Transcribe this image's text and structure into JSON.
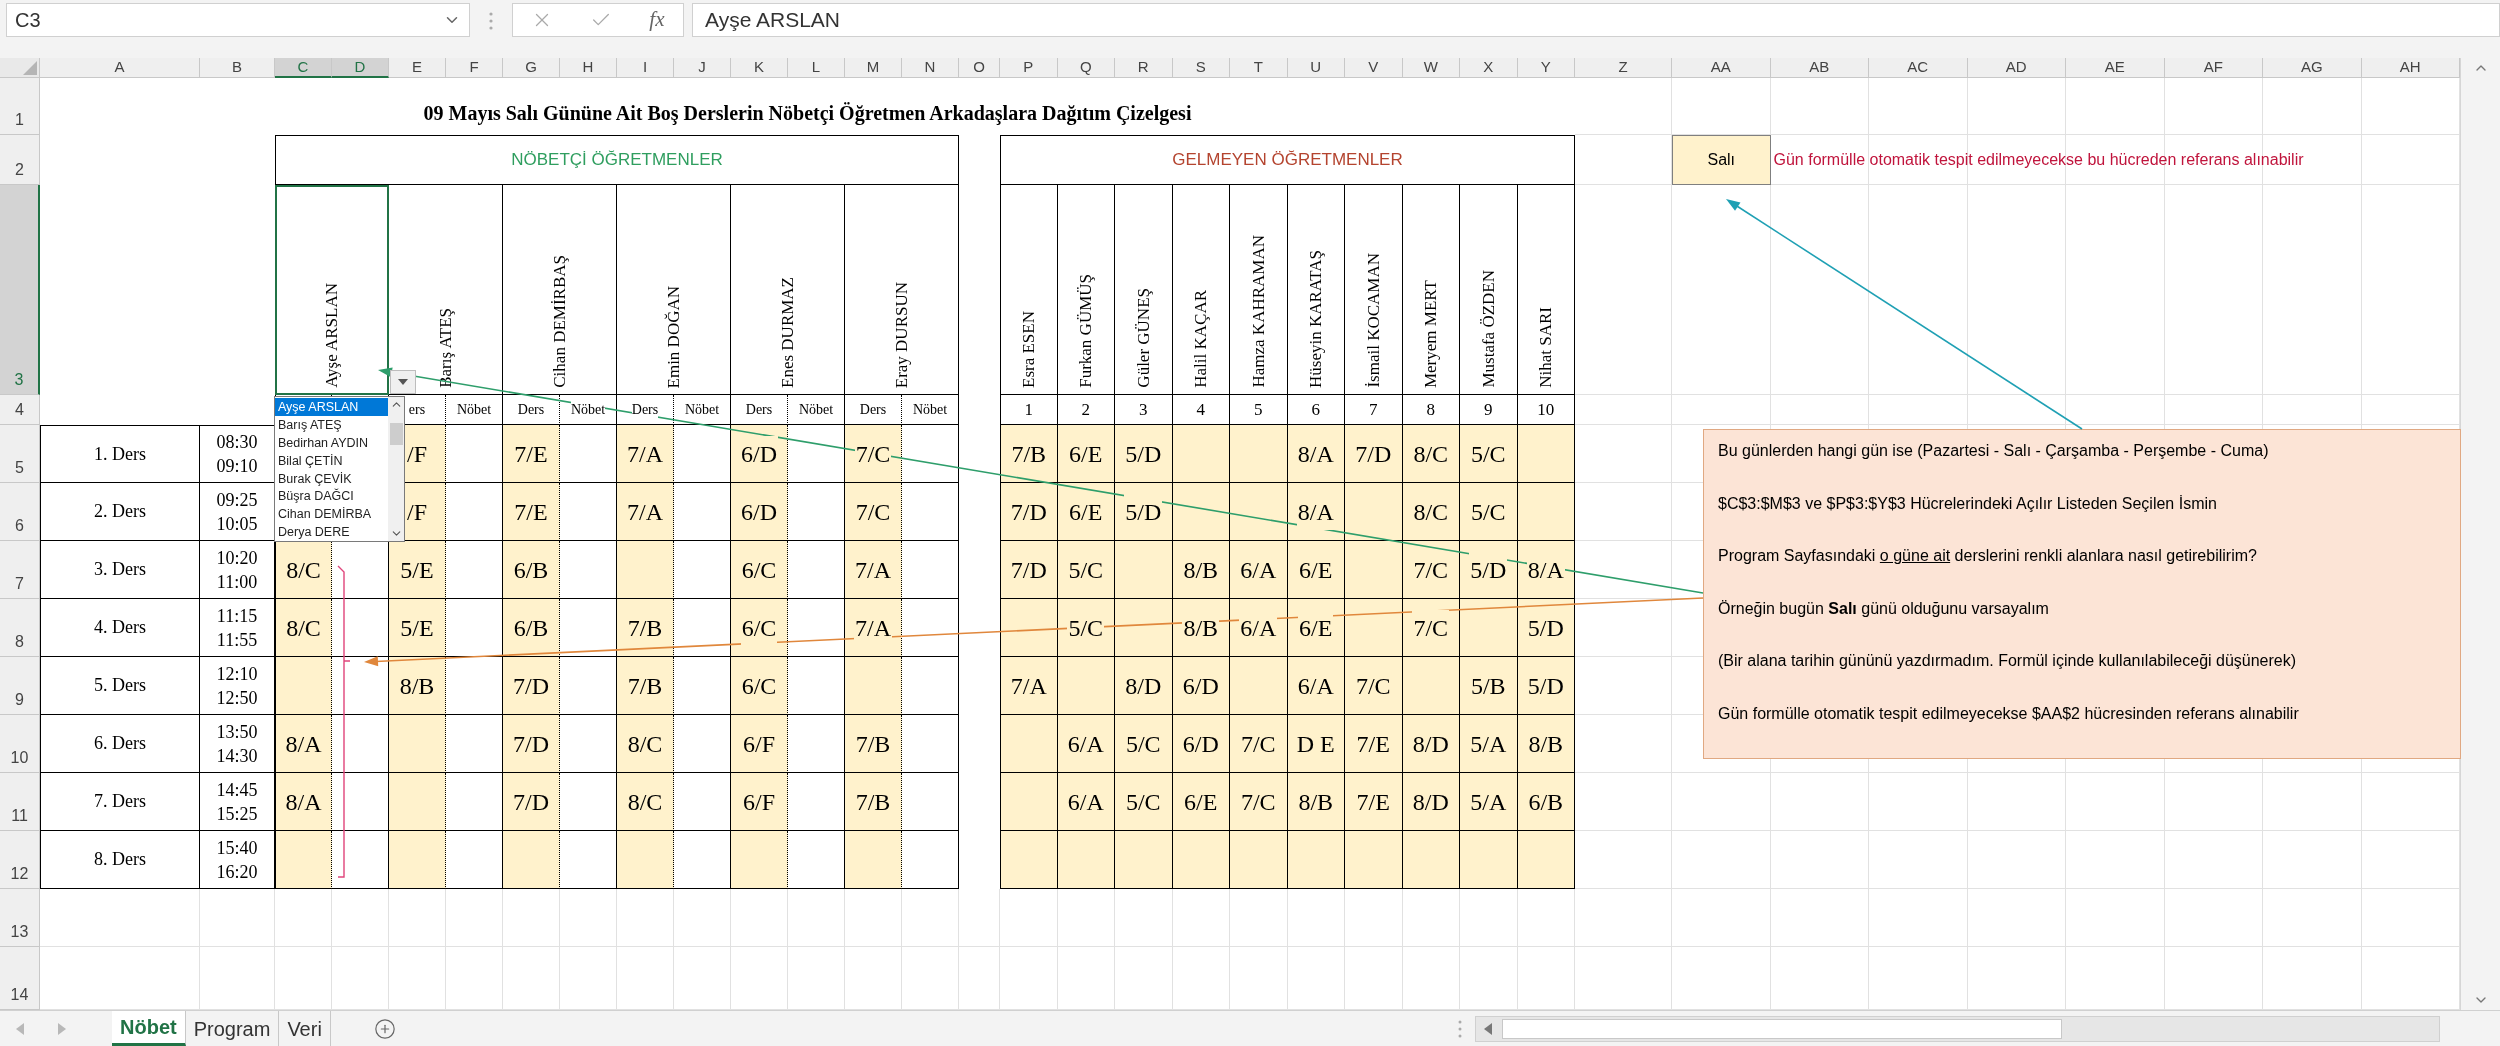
{
  "formula_bar": {
    "name_box": "C3",
    "function_label": "fx",
    "formula": "Ayşe ARSLAN"
  },
  "column_headers": [
    {
      "label": "A",
      "selected": false
    },
    {
      "label": "B",
      "selected": false
    },
    {
      "label": "C",
      "selected": true
    },
    {
      "label": "D",
      "selected": true
    },
    {
      "label": "E",
      "selected": false
    },
    {
      "label": "F",
      "selected": false
    },
    {
      "label": "G",
      "selected": false
    },
    {
      "label": "H",
      "selected": false
    },
    {
      "label": "I",
      "selected": false
    },
    {
      "label": "J",
      "selected": false
    },
    {
      "label": "K",
      "selected": false
    },
    {
      "label": "L",
      "selected": false
    },
    {
      "label": "M",
      "selected": false
    },
    {
      "label": "N",
      "selected": false
    },
    {
      "label": "O",
      "selected": false
    },
    {
      "label": "P",
      "selected": false
    },
    {
      "label": "Q",
      "selected": false
    },
    {
      "label": "R",
      "selected": false
    },
    {
      "label": "S",
      "selected": false
    },
    {
      "label": "T",
      "selected": false
    },
    {
      "label": "U",
      "selected": false
    },
    {
      "label": "V",
      "selected": false
    },
    {
      "label": "W",
      "selected": false
    },
    {
      "label": "X",
      "selected": false
    },
    {
      "label": "Y",
      "selected": false
    },
    {
      "label": "Z",
      "selected": false
    },
    {
      "label": "AA",
      "selected": false
    },
    {
      "label": "AB",
      "selected": false
    },
    {
      "label": "AC",
      "selected": false
    },
    {
      "label": "AD",
      "selected": false
    },
    {
      "label": "AE",
      "selected": false
    },
    {
      "label": "AF",
      "selected": false
    },
    {
      "label": "AG",
      "selected": false
    },
    {
      "label": "AH",
      "selected": false
    }
  ],
  "row_headers": [
    {
      "label": "1",
      "selected": false
    },
    {
      "label": "2",
      "selected": false
    },
    {
      "label": "3",
      "selected": true
    },
    {
      "label": "4",
      "selected": false
    },
    {
      "label": "5",
      "selected": false
    },
    {
      "label": "6",
      "selected": false
    },
    {
      "label": "7",
      "selected": false
    },
    {
      "label": "8",
      "selected": false
    },
    {
      "label": "9",
      "selected": false
    },
    {
      "label": "10",
      "selected": false
    },
    {
      "label": "11",
      "selected": false
    },
    {
      "label": "12",
      "selected": false
    },
    {
      "label": "13",
      "selected": false
    },
    {
      "label": "14",
      "selected": false
    }
  ],
  "title": "09 Mayıs Salı Gününe Ait Boş Derslerin Nöbetçi Öğretmen Arkadaşlara Dağıtım Çizelgesi",
  "duty_table": {
    "heading": "NÖBETÇİ ÖĞRETMENLER",
    "teachers": [
      {
        "name": "Ayşe ARSLAN",
        "selected": true
      },
      {
        "name": "Barış ATEŞ",
        "selected": false,
        "sub_headers": [
          "ers",
          "Nöbet"
        ]
      },
      {
        "name": "Cihan DEMİRBAŞ",
        "selected": false,
        "sub_headers": [
          "Ders",
          "Nöbet"
        ]
      },
      {
        "name": "Emin DOĞAN",
        "selected": false,
        "sub_headers": [
          "Ders",
          "Nöbet"
        ]
      },
      {
        "name": "Enes DURMAZ",
        "selected": false,
        "sub_headers": [
          "Ders",
          "Nöbet"
        ]
      },
      {
        "name": "Eray DURSUN",
        "selected": false,
        "sub_headers": [
          "Ders",
          "Nöbet"
        ]
      }
    ]
  },
  "absent_table": {
    "heading": "GELMEYEN ÖĞRETMENLER",
    "teachers": [
      {
        "name": "Esra ESEN",
        "number": "1"
      },
      {
        "name": "Furkan GÜMÜŞ",
        "number": "2"
      },
      {
        "name": "Güler GÜNEŞ",
        "number": "3"
      },
      {
        "name": "Halil KAÇAR",
        "number": "4"
      },
      {
        "name": "Hamza KAHRAMAN",
        "number": "5"
      },
      {
        "name": "Hüseyin KARATAŞ",
        "number": "6"
      },
      {
        "name": "İsmail KOCAMAN",
        "number": "7"
      },
      {
        "name": "Meryem MERT",
        "number": "8"
      },
      {
        "name": "Mustafa ÖZDEN",
        "number": "9"
      },
      {
        "name": "Nihat SARI",
        "number": "10"
      }
    ]
  },
  "periods": [
    {
      "label": "1. Ders",
      "start": "08:30",
      "end": "09:10",
      "duty": [
        {
          "kind": "hidden"
        },
        {
          "kind": "lesson",
          "text": "/F"
        },
        {
          "kind": "lesson",
          "text": "7/E"
        },
        {
          "kind": "lesson",
          "text": "7/A"
        },
        {
          "kind": "lesson",
          "text": "6/D"
        },
        {
          "kind": "lesson",
          "text": "7/C"
        }
      ],
      "absent": [
        {
          "kind": "lesson",
          "text": "7/B"
        },
        {
          "kind": "lesson",
          "text": "6/E"
        },
        {
          "kind": "lesson",
          "text": "5/D"
        },
        {
          "kind": "empty"
        },
        {
          "kind": "empty"
        },
        {
          "kind": "lesson",
          "text": "8/A"
        },
        {
          "kind": "lesson",
          "text": "7/D"
        },
        {
          "kind": "lesson",
          "text": "8/C"
        },
        {
          "kind": "lesson",
          "text": "5/C"
        },
        {
          "kind": "empty"
        }
      ]
    },
    {
      "label": "2. Ders",
      "start": "09:25",
      "end": "10:05",
      "duty": [
        {
          "kind": "hidden"
        },
        {
          "kind": "lesson",
          "text": "/F"
        },
        {
          "kind": "lesson",
          "text": "7/E"
        },
        {
          "kind": "lesson",
          "text": "7/A"
        },
        {
          "kind": "lesson",
          "text": "6/D"
        },
        {
          "kind": "lesson",
          "text": "7/C"
        }
      ],
      "absent": [
        {
          "kind": "lesson",
          "text": "7/D"
        },
        {
          "kind": "lesson",
          "text": "6/E"
        },
        {
          "kind": "lesson",
          "text": "5/D"
        },
        {
          "kind": "empty"
        },
        {
          "kind": "empty"
        },
        {
          "kind": "lesson",
          "text": "8/A"
        },
        {
          "kind": "empty"
        },
        {
          "kind": "lesson",
          "text": "8/C"
        },
        {
          "kind": "lesson",
          "text": "5/C"
        },
        {
          "kind": "empty"
        }
      ]
    },
    {
      "label": "3. Ders",
      "start": "10:20",
      "end": "11:00",
      "duty": [
        {
          "kind": "lesson",
          "text": "8/C"
        },
        {
          "kind": "lesson",
          "text": "5/E"
        },
        {
          "kind": "lesson",
          "text": "6/B"
        },
        {
          "kind": "empty"
        },
        {
          "kind": "lesson",
          "text": "6/C"
        },
        {
          "kind": "lesson",
          "text": "7/A"
        }
      ],
      "absent": [
        {
          "kind": "lesson",
          "text": "7/D"
        },
        {
          "kind": "lesson",
          "text": "5/C"
        },
        {
          "kind": "empty"
        },
        {
          "kind": "lesson",
          "text": "8/B"
        },
        {
          "kind": "lesson",
          "text": "6/A"
        },
        {
          "kind": "lesson",
          "text": "6/E"
        },
        {
          "kind": "empty"
        },
        {
          "kind": "lesson",
          "text": "7/C"
        },
        {
          "kind": "lesson",
          "text": "5/D"
        },
        {
          "kind": "lesson",
          "text": "8/A"
        }
      ]
    },
    {
      "label": "4. Ders",
      "start": "11:15",
      "end": "11:55",
      "duty": [
        {
          "kind": "lesson",
          "text": "8/C"
        },
        {
          "kind": "lesson",
          "text": "5/E"
        },
        {
          "kind": "lesson",
          "text": "6/B"
        },
        {
          "kind": "lesson",
          "text": "7/B"
        },
        {
          "kind": "lesson",
          "text": "6/C"
        },
        {
          "kind": "lesson",
          "text": "7/A"
        }
      ],
      "absent": [
        {
          "kind": "empty"
        },
        {
          "kind": "lesson",
          "text": "5/C"
        },
        {
          "kind": "empty"
        },
        {
          "kind": "lesson",
          "text": "8/B"
        },
        {
          "kind": "lesson",
          "text": "6/A"
        },
        {
          "kind": "lesson",
          "text": "6/E"
        },
        {
          "kind": "empty"
        },
        {
          "kind": "lesson",
          "text": "7/C"
        },
        {
          "kind": "empty"
        },
        {
          "kind": "lesson",
          "text": "5/D"
        }
      ]
    },
    {
      "label": "5. Ders",
      "start": "12:10",
      "end": "12:50",
      "duty": [
        {
          "kind": "empty"
        },
        {
          "kind": "lesson",
          "text": "8/B"
        },
        {
          "kind": "lesson",
          "text": "7/D"
        },
        {
          "kind": "lesson",
          "text": "7/B"
        },
        {
          "kind": "lesson",
          "text": "6/C"
        },
        {
          "kind": "empty"
        }
      ],
      "absent": [
        {
          "kind": "lesson",
          "text": "7/A"
        },
        {
          "kind": "empty"
        },
        {
          "kind": "lesson",
          "text": "8/D"
        },
        {
          "kind": "lesson",
          "text": "6/D"
        },
        {
          "kind": "empty"
        },
        {
          "kind": "lesson",
          "text": "6/A"
        },
        {
          "kind": "lesson",
          "text": "7/C"
        },
        {
          "kind": "empty"
        },
        {
          "kind": "lesson",
          "text": "5/B"
        },
        {
          "kind": "lesson",
          "text": "5/D"
        }
      ]
    },
    {
      "label": "6. Ders",
      "start": "13:50",
      "end": "14:30",
      "duty": [
        {
          "kind": "lesson",
          "text": "8/A"
        },
        {
          "kind": "empty"
        },
        {
          "kind": "lesson",
          "text": "7/D"
        },
        {
          "kind": "lesson",
          "text": "8/C"
        },
        {
          "kind": "lesson",
          "text": "6/F"
        },
        {
          "kind": "lesson",
          "text": "7/B"
        }
      ],
      "absent": [
        {
          "kind": "empty"
        },
        {
          "kind": "lesson",
          "text": "6/A"
        },
        {
          "kind": "lesson",
          "text": "5/C"
        },
        {
          "kind": "lesson",
          "text": "6/D"
        },
        {
          "kind": "lesson",
          "text": "7/C"
        },
        {
          "kind": "lesson",
          "text": "D E"
        },
        {
          "kind": "lesson",
          "text": "7/E"
        },
        {
          "kind": "lesson",
          "text": "8/D"
        },
        {
          "kind": "lesson",
          "text": "5/A"
        },
        {
          "kind": "lesson",
          "text": "8/B"
        }
      ]
    },
    {
      "label": "7. Ders",
      "start": "14:45",
      "end": "15:25",
      "duty": [
        {
          "kind": "lesson",
          "text": "8/A"
        },
        {
          "kind": "empty"
        },
        {
          "kind": "lesson",
          "text": "7/D"
        },
        {
          "kind": "lesson",
          "text": "8/C"
        },
        {
          "kind": "lesson",
          "text": "6/F"
        },
        {
          "kind": "lesson",
          "text": "7/B"
        }
      ],
      "absent": [
        {
          "kind": "empty"
        },
        {
          "kind": "lesson",
          "text": "6/A"
        },
        {
          "kind": "lesson",
          "text": "5/C"
        },
        {
          "kind": "lesson",
          "text": "6/E"
        },
        {
          "kind": "lesson",
          "text": "7/C"
        },
        {
          "kind": "lesson",
          "text": "8/B"
        },
        {
          "kind": "lesson",
          "text": "7/E"
        },
        {
          "kind": "lesson",
          "text": "8/D"
        },
        {
          "kind": "lesson",
          "text": "5/A"
        },
        {
          "kind": "lesson",
          "text": "6/B"
        }
      ]
    },
    {
      "label": "8. Ders",
      "start": "15:40",
      "end": "16:20",
      "duty": [
        {
          "kind": "empty"
        },
        {
          "kind": "empty"
        },
        {
          "kind": "empty"
        },
        {
          "kind": "empty"
        },
        {
          "kind": "empty"
        },
        {
          "kind": "empty"
        }
      ],
      "absent": [
        {
          "kind": "empty"
        },
        {
          "kind": "empty"
        },
        {
          "kind": "empty"
        },
        {
          "kind": "empty"
        },
        {
          "kind": "empty"
        },
        {
          "kind": "empty"
        },
        {
          "kind": "empty"
        },
        {
          "kind": "empty"
        },
        {
          "kind": "empty"
        },
        {
          "kind": "empty"
        }
      ]
    }
  ],
  "dropdown": {
    "items": [
      {
        "label": "Ayşe ARSLAN",
        "selected": true
      },
      {
        "label": "Barış ATEŞ",
        "selected": false
      },
      {
        "label": "Bedirhan AYDIN",
        "selected": false
      },
      {
        "label": "Bilal ÇETİN",
        "selected": false
      },
      {
        "label": "Burak ÇEVİK",
        "selected": false
      },
      {
        "label": "Büşra DAĞCI",
        "selected": false
      },
      {
        "label": "Cihan DEMİRBA",
        "selected": false
      },
      {
        "label": "Derya DERE",
        "selected": false
      }
    ]
  },
  "day_cell": {
    "value": "Salı",
    "note": "Gün formülle otomatik tespit edilmeyecekse bu hücreden referans alınabilir"
  },
  "note_box": {
    "lines": [
      {
        "segments": [
          {
            "text": "Bu günlerden hangi gün ise (Pazartesi - Salı - Çarşamba - Perşembe - Cuma)",
            "underline": false
          }
        ]
      },
      {
        "segments": [
          {
            "text": "$C$3:$M$3 ve $P$3:$Y$3 Hücrelerindeki Açılır Listeden Seçilen İsmin",
            "underline": false
          }
        ]
      },
      {
        "segments": [
          {
            "text": "Program Sayfasındaki ",
            "underline": false
          },
          {
            "text": "o güne ait",
            "underline": true
          },
          {
            "text": " derslerini renkli alanlara nasıl getirebilirim?",
            "underline": false
          }
        ]
      },
      {
        "segments": [
          {
            "text": "Örneğin bugün **Salı** günü olduğunu varsayalım",
            "underline": false
          }
        ]
      },
      {
        "segments": [
          {
            "text": "(Bir alana tarihin gününü yazdırmadım. Formül içinde kullanılabileceği düşünerek)",
            "underline": false
          }
        ]
      },
      {
        "segments": [
          {
            "text": "Gün formülle otomatik tespit edilmeyecekse $AA$2 hücresinden referans alınabilir",
            "underline": false
          }
        ]
      }
    ]
  },
  "sheet_tabs": [
    {
      "label": "Nöbet",
      "selected": true
    },
    {
      "label": "Program",
      "selected": false
    },
    {
      "label": "Veri",
      "selected": false
    }
  ]
}
